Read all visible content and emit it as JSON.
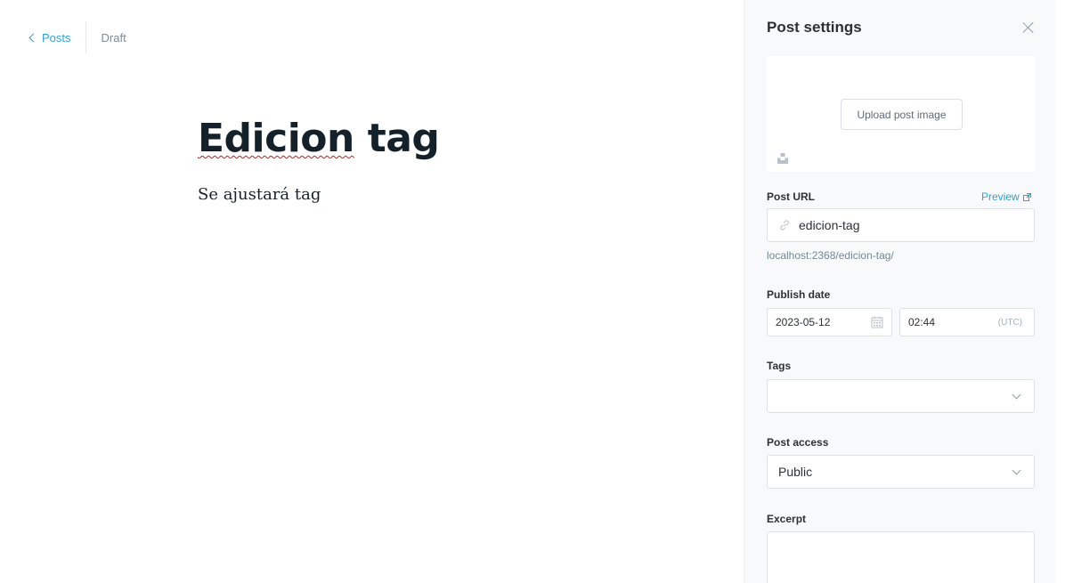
{
  "header": {
    "back_label": "Posts",
    "status": "Draft"
  },
  "post": {
    "title_word1": "Edicion",
    "title_word2": "tag",
    "body": "Se ajustará tag"
  },
  "settings": {
    "title": "Post settings",
    "upload_label": "Upload post image",
    "url": {
      "label": "Post URL",
      "preview_label": "Preview",
      "value": "edicion-tag",
      "hint": "localhost:2368/edicion-tag/"
    },
    "publish": {
      "label": "Publish date",
      "date": "2023-05-12",
      "time": "02:44",
      "timezone": "(UTC)"
    },
    "tags": {
      "label": "Tags",
      "value": ""
    },
    "access": {
      "label": "Post access",
      "value": "Public"
    },
    "excerpt": {
      "label": "Excerpt",
      "value": ""
    }
  },
  "colors": {
    "accent": "#30a3d6",
    "panel_bg": "#f8f9fa",
    "text": "#15212a"
  },
  "icons": [
    "chevron-left-icon",
    "close-icon",
    "unsplash-icon",
    "link-icon",
    "external-link-icon",
    "calendar-icon",
    "chevron-down-icon"
  ]
}
